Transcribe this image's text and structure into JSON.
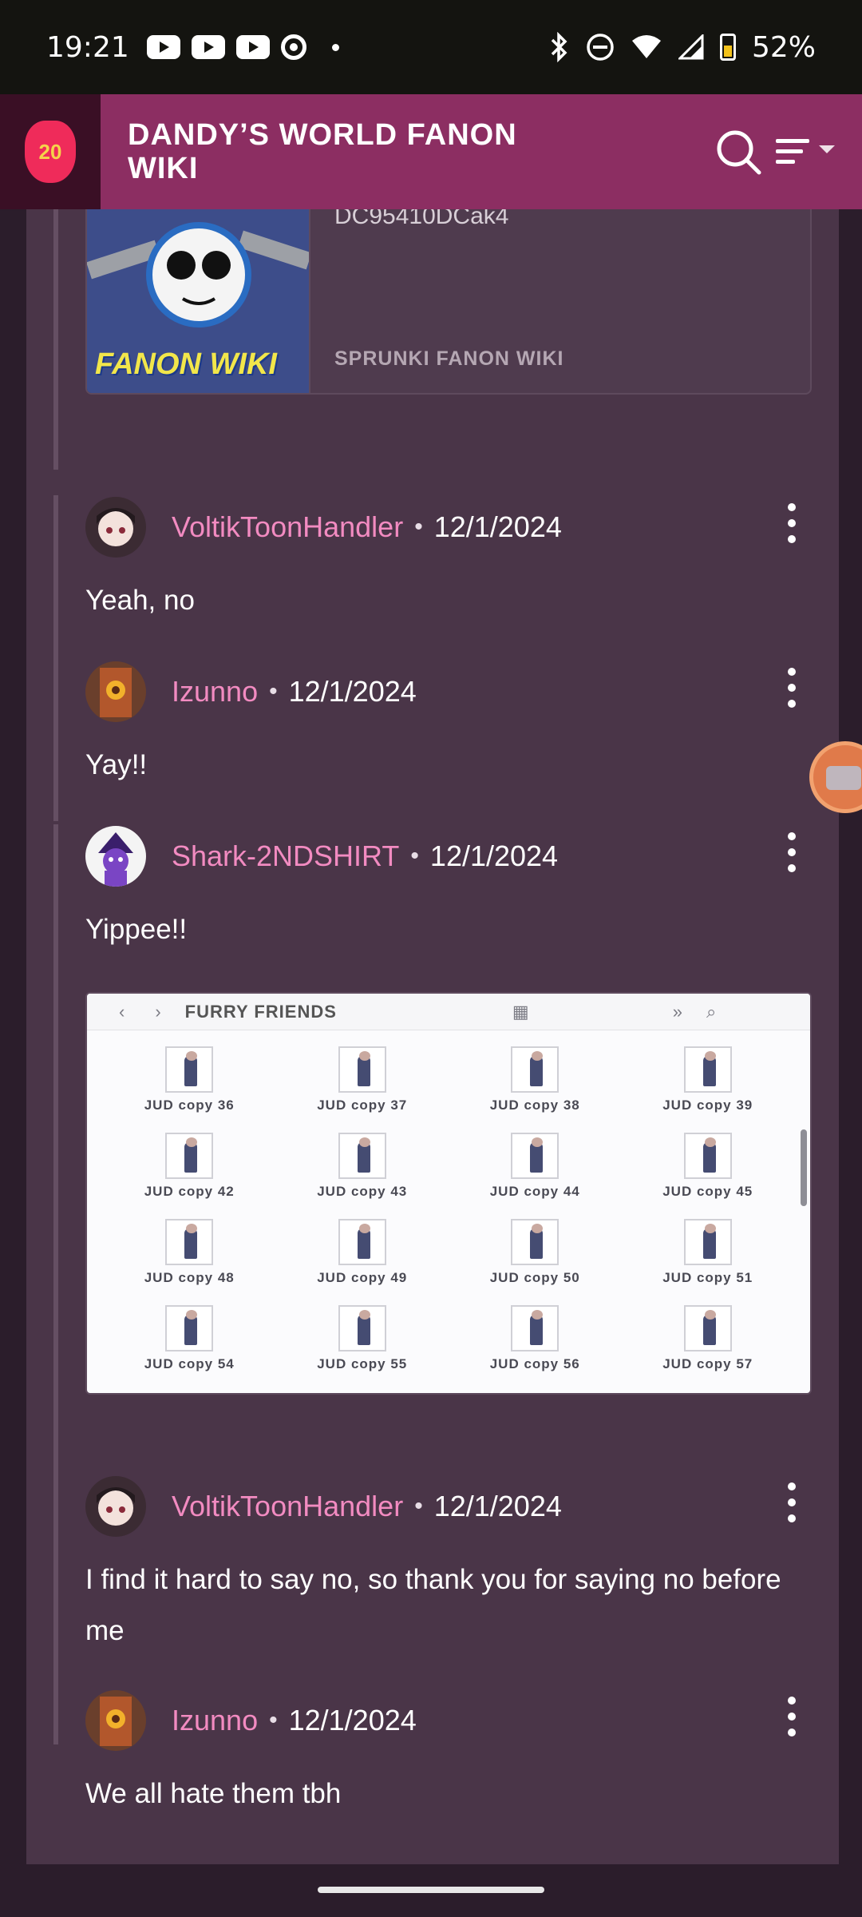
{
  "status_bar": {
    "time": "19:21",
    "notification_icons": [
      "youtube-icon",
      "youtube-icon",
      "youtube-icon",
      "chrome-icon",
      "dot-icon"
    ],
    "system_icons": [
      "bluetooth-icon",
      "do-not-disturb-icon",
      "wifi-icon",
      "signal-icon",
      "battery-icon"
    ],
    "battery": "52%"
  },
  "header": {
    "logo_text": "20",
    "title": "DANDY’S WORLD FANON WIKI",
    "colors": {
      "bar": "#8c2e62",
      "logo_bg": "#3a0f25"
    }
  },
  "embed": {
    "code": "DC95410DCak4",
    "source": "SPRUNKI FANON WIKI",
    "thumb_text": "FANON WIKI"
  },
  "comments": [
    {
      "author": "VoltikToonHandler",
      "date": "12/1/2024",
      "text": "Yeah, no"
    },
    {
      "author": "Izunno",
      "date": "12/1/2024",
      "text": "Yay!!"
    },
    {
      "author": "Shark-2NDSHIRT",
      "date": "12/1/2024",
      "text": "Yippee!!"
    },
    {
      "author": "VoltikToonHandler",
      "date": "12/1/2024",
      "text": "I find it hard to say no, so thank you for saying no before me"
    },
    {
      "author": "Izunno",
      "date": "12/1/2024",
      "text": "We all hate them tbh"
    }
  ],
  "separator": "•",
  "attachment": {
    "title": "FURRY FRIENDS",
    "files": [
      "JUD copy 36",
      "JUD copy 37",
      "JUD copy 38",
      "JUD copy 39",
      "JUD copy 42",
      "JUD copy 43",
      "JUD copy 44",
      "JUD copy 45",
      "JUD copy 48",
      "JUD copy 49",
      "JUD copy 50",
      "JUD copy 51",
      "JUD copy 54",
      "JUD copy 55",
      "JUD copy 56",
      "JUD copy 57"
    ]
  },
  "colors": {
    "author": "#f28bc1",
    "content_bg": "#4a3548"
  }
}
